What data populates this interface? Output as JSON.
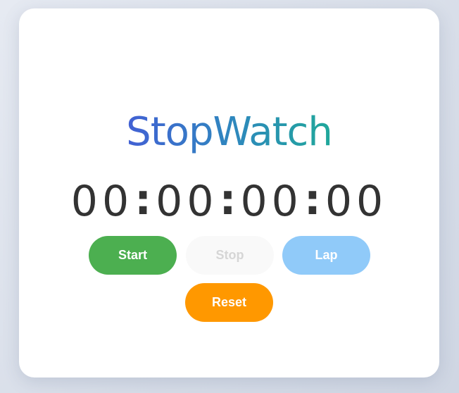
{
  "app": {
    "title": "StopWatch"
  },
  "display": {
    "hours": "00",
    "minutes": "00",
    "seconds": "00",
    "centiseconds": "00",
    "separator": ":"
  },
  "buttons": {
    "start_label": "Start",
    "stop_label": "Stop",
    "lap_label": "Lap",
    "reset_label": "Reset"
  },
  "colors": {
    "start": "#4caf50",
    "stop": "#f9f9f9",
    "lap": "#90caf9",
    "reset": "#ff9800",
    "title_gradient_start": "#4260d4",
    "title_gradient_end": "#1fa89a"
  }
}
